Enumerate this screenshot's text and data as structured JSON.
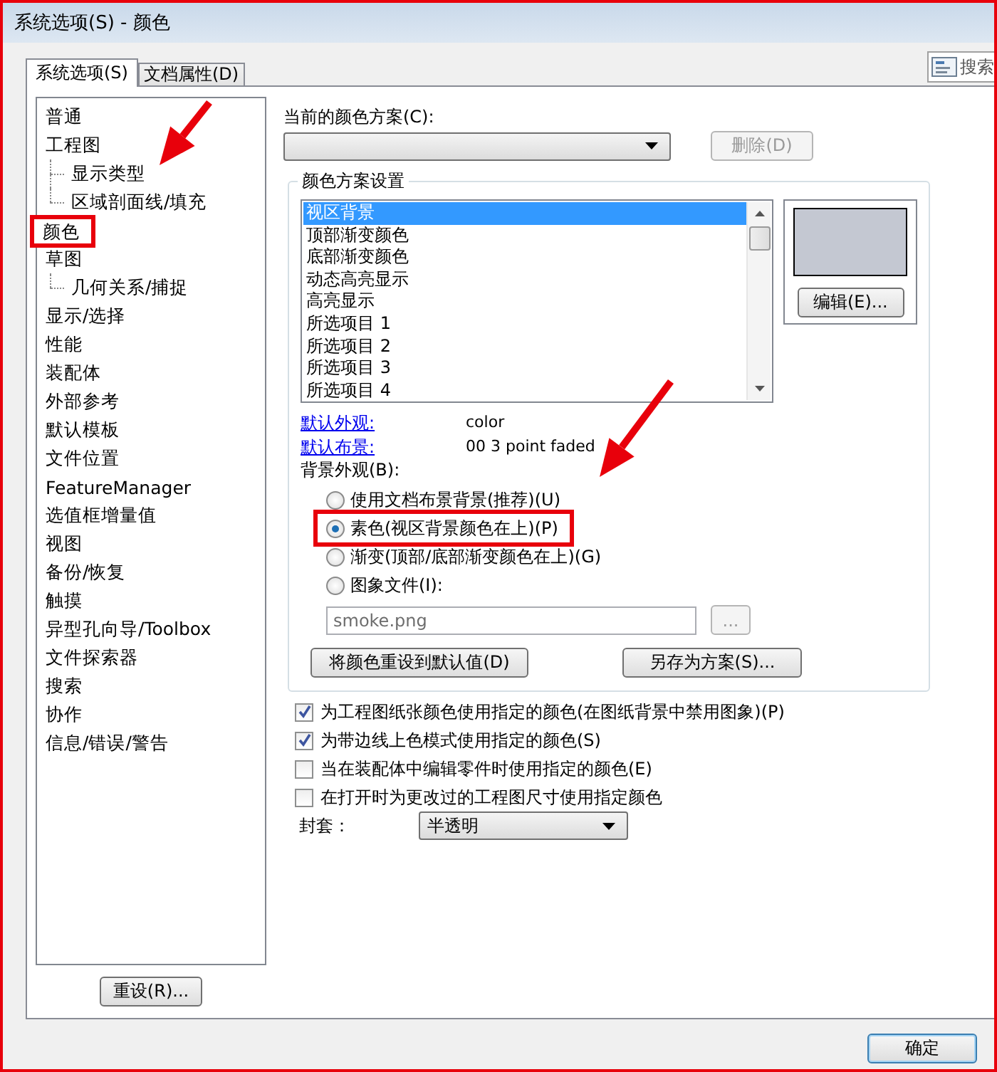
{
  "window": {
    "title": "系统选项(S) - 颜色"
  },
  "tabs": [
    {
      "label": "系统选项(S)",
      "selected": true
    },
    {
      "label": "文档属性(D)",
      "selected": false
    }
  ],
  "search": {
    "placeholder": "搜索"
  },
  "sidebar": {
    "items": [
      {
        "label": "普通",
        "highlighted": false
      },
      {
        "label": "工程图",
        "highlighted": false,
        "children": [
          {
            "label": "显示类型",
            "highlighted": false
          },
          {
            "label": "区域剖面线/填充",
            "highlighted": false
          }
        ]
      },
      {
        "label": "颜色",
        "highlighted": true
      },
      {
        "label": "草图",
        "highlighted": false,
        "children": [
          {
            "label": "几何关系/捕捉",
            "highlighted": false
          }
        ]
      },
      {
        "label": "显示/选择",
        "highlighted": false
      },
      {
        "label": "性能",
        "highlighted": false
      },
      {
        "label": "装配体",
        "highlighted": false
      },
      {
        "label": "外部参考",
        "highlighted": false
      },
      {
        "label": "默认模板",
        "highlighted": false
      },
      {
        "label": "文件位置",
        "highlighted": false
      },
      {
        "label": "FeatureManager",
        "highlighted": false
      },
      {
        "label": "选值框增量值",
        "highlighted": false
      },
      {
        "label": "视图",
        "highlighted": false
      },
      {
        "label": "备份/恢复",
        "highlighted": false
      },
      {
        "label": "触摸",
        "highlighted": false
      },
      {
        "label": "异型孔向导/Toolbox",
        "highlighted": false
      },
      {
        "label": "文件探索器",
        "highlighted": false
      },
      {
        "label": "搜索",
        "highlighted": false
      },
      {
        "label": "协作",
        "highlighted": false
      },
      {
        "label": "信息/错误/警告",
        "highlighted": false
      }
    ]
  },
  "reset_button": "重设(R)...",
  "color_scheme": {
    "label": "当前的颜色方案(C):",
    "delete_button": {
      "label": "删除(D)",
      "disabled": true
    }
  },
  "scheme_settings": {
    "title": "颜色方案设置",
    "items": [
      {
        "label": "视区背景",
        "selected": true
      },
      {
        "label": "顶部渐变颜色",
        "selected": false
      },
      {
        "label": "底部渐变颜色",
        "selected": false
      },
      {
        "label": "动态高亮显示",
        "selected": false
      },
      {
        "label": "高亮显示",
        "selected": false
      },
      {
        "label": "所选项目 1",
        "selected": false
      },
      {
        "label": "所选项目 2",
        "selected": false
      },
      {
        "label": "所选项目 3",
        "selected": false
      },
      {
        "label": "所选项目 4",
        "selected": false
      }
    ],
    "edit_button": "编辑(E)...",
    "defaults": [
      {
        "link": "默认外观:",
        "value": "color"
      },
      {
        "link": "默认布景:",
        "value": "00 3 point faded"
      }
    ],
    "background_label": "背景外观(B):",
    "background_options": [
      {
        "label": "使用文档布景背景(推荐)(U)",
        "selected": false,
        "highlighted": false
      },
      {
        "label": "素色(视区背景颜色在上)(P)",
        "selected": true,
        "highlighted": true
      },
      {
        "label": "渐变(顶部/底部渐变颜色在上)(G)",
        "selected": false,
        "highlighted": false
      },
      {
        "label": "图象文件(I):",
        "selected": false,
        "highlighted": false
      }
    ],
    "image_file": {
      "value": "smoke.png",
      "disabled": true
    },
    "browse_button": {
      "label": "...",
      "disabled": true
    },
    "reset_colors_button": "将颜色重设到默认值(D)",
    "save_scheme_button": "另存为方案(S)..."
  },
  "options": [
    {
      "label": "为工程图纸张颜色使用指定的颜色(在图纸背景中禁用图象)(P)",
      "checked": true
    },
    {
      "label": "为带边线上色模式使用指定的颜色(S)",
      "checked": true
    },
    {
      "label": "当在装配体中编辑零件时使用指定的颜色(E)",
      "checked": false
    },
    {
      "label": "在打开时为更改过的工程图尺寸使用指定颜色",
      "checked": false
    }
  ],
  "envelope": {
    "label": "封套：",
    "value": "半透明"
  },
  "buttons": [
    {
      "label": "确定",
      "default": true
    }
  ]
}
